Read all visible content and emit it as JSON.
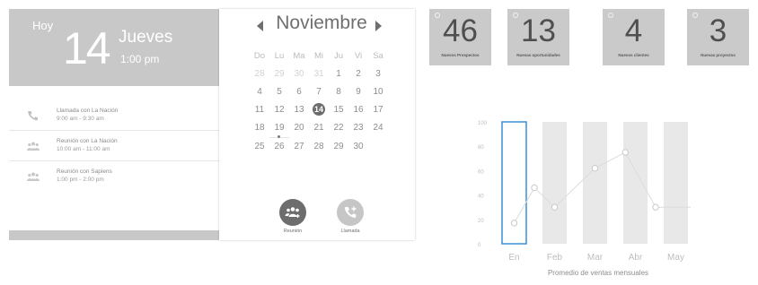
{
  "agenda": {
    "today_label": "Hoy",
    "day_number": "14",
    "weekday": "Jueves",
    "time": "1:00 pm",
    "events": [
      {
        "icon": "phone-icon",
        "title": "Llamada con La Nación",
        "time": "9:00 am - 9:30 am"
      },
      {
        "icon": "group-icon",
        "title": "Reunión con La Nación",
        "time": "10:00 am - 11:00 am"
      },
      {
        "icon": "group-icon",
        "title": "Reunión con Sapiens",
        "time": "1:00 pm - 2:00 pm"
      }
    ]
  },
  "calendar": {
    "month": "Noviembre",
    "prev_icon": "chevron-left-icon",
    "next_icon": "chevron-right-icon",
    "weekdays": [
      "Do",
      "Lu",
      "Ma",
      "Mi",
      "Ju",
      "Vi",
      "Sa"
    ],
    "days": [
      {
        "d": "28",
        "other": true
      },
      {
        "d": "29",
        "other": true
      },
      {
        "d": "30",
        "other": true
      },
      {
        "d": "31",
        "other": true
      },
      {
        "d": "1"
      },
      {
        "d": "2"
      },
      {
        "d": "3"
      },
      {
        "d": "4"
      },
      {
        "d": "5"
      },
      {
        "d": "6"
      },
      {
        "d": "7"
      },
      {
        "d": "8"
      },
      {
        "d": "9"
      },
      {
        "d": "10"
      },
      {
        "d": "11"
      },
      {
        "d": "12"
      },
      {
        "d": "13"
      },
      {
        "d": "14",
        "today": true
      },
      {
        "d": "15"
      },
      {
        "d": "16"
      },
      {
        "d": "17"
      },
      {
        "d": "18"
      },
      {
        "d": "19",
        "event": true
      },
      {
        "d": "20"
      },
      {
        "d": "21"
      },
      {
        "d": "22"
      },
      {
        "d": "23"
      },
      {
        "d": "24"
      },
      {
        "d": "25"
      },
      {
        "d": "26"
      },
      {
        "d": "27"
      },
      {
        "d": "28"
      },
      {
        "d": "29"
      },
      {
        "d": "30"
      }
    ],
    "buttons": [
      {
        "icon": "add-group-icon",
        "label": "Reunión"
      },
      {
        "icon": "add-call-icon",
        "label": "Llamada"
      }
    ]
  },
  "stats": [
    {
      "value": "46",
      "label": "Nuevos Prospectos"
    },
    {
      "value": "13",
      "label": "Nuevas oportunidades"
    },
    {
      "value": "4",
      "label": "Nuevos clientes"
    },
    {
      "value": "3",
      "label": "Nuevas proyectos"
    }
  ],
  "chart_data": {
    "type": "line",
    "categories": [
      "En",
      "Feb",
      "Mar",
      "Abr",
      "May"
    ],
    "y_ticks": [
      0,
      20,
      40,
      60,
      80,
      100
    ],
    "ylim": [
      0,
      100
    ],
    "x": [
      0.0,
      0.5,
      1.0,
      2.0,
      2.75,
      3.5,
      4.0
    ],
    "values": [
      17,
      46,
      30,
      62,
      75,
      30,
      30
    ],
    "xlabel": "Promedio de ventas mensuales",
    "selected_category": "En",
    "grid": false,
    "colors": {
      "bars": "#e8e8e8",
      "line": "#dcdcdc",
      "points": "#c9c9c9",
      "selected": "#3a8fd6",
      "ticks": "#bdbdbd"
    }
  }
}
